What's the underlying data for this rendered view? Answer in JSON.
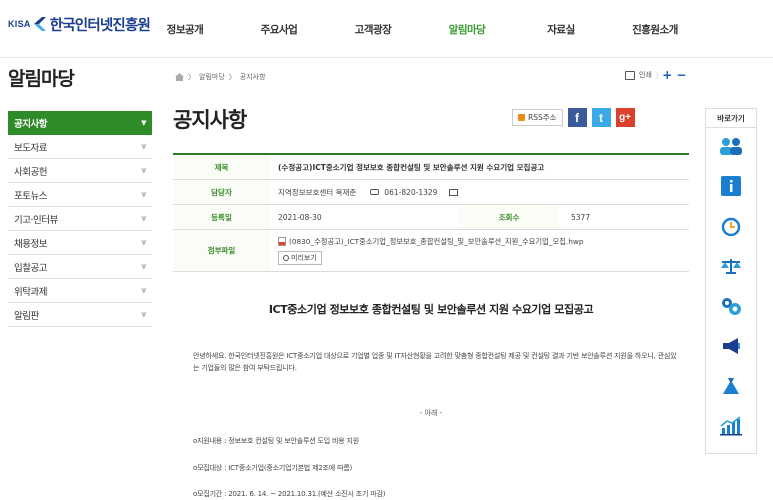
{
  "header": {
    "logo_kisa": "KISA",
    "logo_name": "한국인터넷진흥원",
    "nav": [
      "정보공개",
      "주요사업",
      "고객광장",
      "알림마당",
      "자료실",
      "진흥원소개"
    ],
    "active_nav": "알림마당"
  },
  "sidebar": {
    "title": "알림마당",
    "items": [
      {
        "label": "공지사항"
      },
      {
        "label": "보도자료"
      },
      {
        "label": "사회공헌"
      },
      {
        "label": "포토뉴스"
      },
      {
        "label": "기고·인터뷰"
      },
      {
        "label": "채용정보"
      },
      {
        "label": "입찰공고"
      },
      {
        "label": "위탁과제"
      },
      {
        "label": "알림판"
      }
    ],
    "active_item": "공지사항"
  },
  "breadcrumb": {
    "items": [
      "알림마당",
      "공지사항"
    ]
  },
  "tools": {
    "print_label": "인쇄",
    "zoom_in": "+",
    "zoom_out": "−"
  },
  "page_title": "공지사항",
  "share": {
    "rss_label": "RSS주소",
    "facebook": "f",
    "twitter": "t",
    "google": "g+"
  },
  "post": {
    "subject_label": "제목",
    "subject": "(수정공고)ICT중소기업 정보보호 종합컨설팅 및 보안솔루션 지원 수요기업 모집공고",
    "manager_label": "담당자",
    "manager": "지역정보보호센터 복재춘",
    "phone": "061-820-1329",
    "date_label": "등록일",
    "date": "2021-08-30",
    "views_label": "조회수",
    "views": "5377",
    "attachment_label": "첨부파일",
    "attachment": "(0830_수정공고)_ICT중소기업_정보보호_종합컨설팅_및_보안솔루션_지원_수요기업_모집.hwp",
    "preview_label": "미리보기"
  },
  "content": {
    "title": "ICT중소기업 정보보호 종합컨설팅 및 보안솔루션 지원 수요기업 모집공고",
    "intro": "안녕하세요. 한국인터넷진흥원은 ICT중소기업 대상으로 기업별 업종 및 IT자산현황을 고려한 맞춤형 종합컨설팅 제공 및 컨설팅 결과 기반 보안솔루션 지원을 하오니, 관심있는 기업들의 많은 참여 부탁드립니다.",
    "divider": "- 아래 -",
    "bullets": [
      "o지원내용 : 정보보호 컨설팅 및 보안솔루션 도입 비용 지원",
      "o모집대상 : ICT중소기업(중소기업기본법 제2조에 따름)",
      "o모집기간 : 2021. 6. 14. ~ 2021.10.31.(예산 소진시 조기 마감)"
    ]
  },
  "quick_menu": {
    "title": "바로가기",
    "icons": [
      "people-icon",
      "info-icon",
      "clock-icon",
      "scale-icon",
      "gear-icon",
      "megaphone-icon",
      "moneybag-icon",
      "chart-icon"
    ]
  },
  "colors": {
    "brand_blue": "#1a3d8f",
    "accent_green": "#2f8a2a",
    "nav_active": "#3a9b2f"
  }
}
